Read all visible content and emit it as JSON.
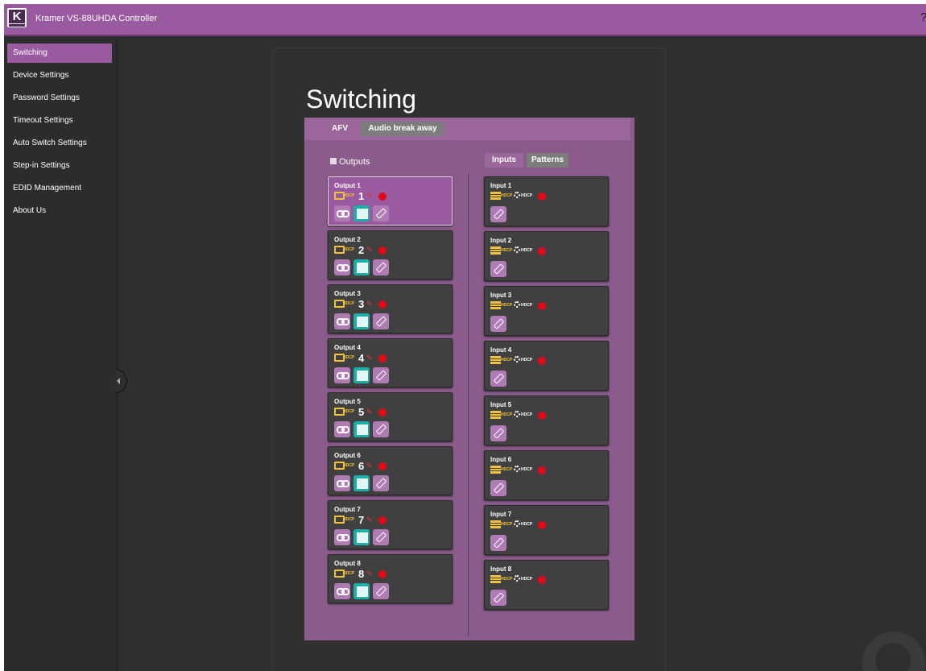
{
  "app": {
    "title": "Kramer VS-88UHDA Controller",
    "logo_letter": "K",
    "help_glyph": "?"
  },
  "sidebar": {
    "items": [
      {
        "label": "Switching",
        "active": true
      },
      {
        "label": "Device Settings"
      },
      {
        "label": "Password Settings"
      },
      {
        "label": "Timeout Settings"
      },
      {
        "label": "Auto Switch Settings"
      },
      {
        "label": "Step-in Settings"
      },
      {
        "label": "EDID Management"
      },
      {
        "label": "About Us"
      }
    ]
  },
  "page": {
    "title": "Switching"
  },
  "mode_tabs": {
    "afv": "AFV",
    "audio_break_away": "Audio break away"
  },
  "outputs": {
    "header": "Outputs",
    "hdcp_label": "HDCP",
    "items": [
      {
        "label": "Output 1",
        "number": "1",
        "selected": true
      },
      {
        "label": "Output 2",
        "number": "2"
      },
      {
        "label": "Output 3",
        "number": "3"
      },
      {
        "label": "Output 4",
        "number": "4"
      },
      {
        "label": "Output 5",
        "number": "5"
      },
      {
        "label": "Output 6",
        "number": "6"
      },
      {
        "label": "Output 7",
        "number": "7"
      },
      {
        "label": "Output 8",
        "number": "8"
      }
    ]
  },
  "inputs": {
    "tab_inputs": "Inputs",
    "tab_patterns": "Patterns",
    "hdcp_label": "HDCP",
    "items": [
      {
        "label": "Input 1"
      },
      {
        "label": "Input 2"
      },
      {
        "label": "Input 3"
      },
      {
        "label": "Input 4"
      },
      {
        "label": "Input 5"
      },
      {
        "label": "Input 6"
      },
      {
        "label": "Input 7"
      },
      {
        "label": "Input 8"
      }
    ]
  },
  "colors": {
    "brand_purple": "#9a5aa0",
    "panel_purple": "#8a5b8b",
    "status_red": "#e20a16",
    "hdcp_yellow": "#f3c23a",
    "screen_teal": "#1ab0a8"
  },
  "icons": {
    "output_row": [
      "monitor-icon",
      "edid-icon",
      "status-dot"
    ],
    "output_buttons": [
      "link-icon",
      "screen-icon",
      "pencil-icon"
    ],
    "input_row": [
      "bars-icon",
      "gear-icon",
      "status-dot"
    ],
    "input_buttons": [
      "pencil-icon"
    ]
  }
}
